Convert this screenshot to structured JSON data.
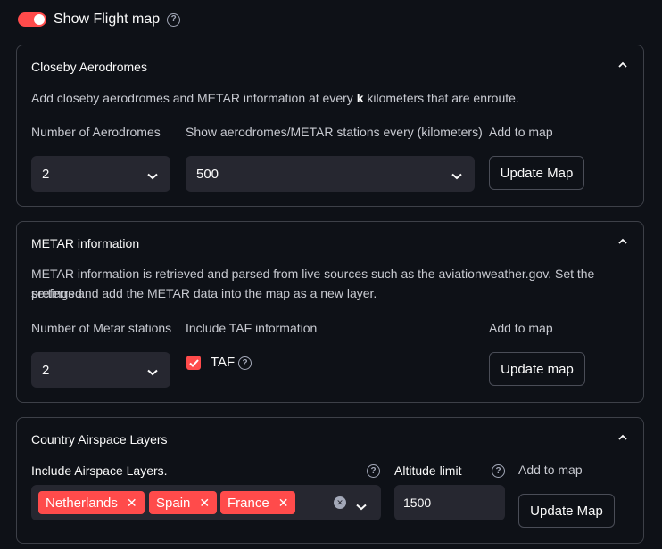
{
  "toggle": {
    "label": "Show Flight map",
    "on": true
  },
  "aerodromes": {
    "title": "Closeby Aerodromes",
    "desc_prefix": "Add closeby aerodromes and METAR information at every",
    "desc_bold": "k",
    "desc_suffix": "kilometers that are enroute.",
    "count_label": "Number of Aerodromes",
    "count_value": "2",
    "every_label": "Show aerodromes/METAR stations every (kilometers)",
    "every_value": "500",
    "add_label": "Add to map",
    "button_label": "Update Map"
  },
  "metar": {
    "title": "METAR information",
    "desc_line1": "METAR information is retrieved and parsed from live sources such as the aviationweather.gov. Set the preferred",
    "desc_line2": "settings and add the METAR data into the map as a new layer.",
    "count_label": "Number of Metar stations",
    "count_value": "2",
    "taf_section_label": "Include TAF information",
    "taf_checkbox_label": "TAF",
    "taf_checked": true,
    "add_label": "Add to map",
    "button_label": "Update map"
  },
  "airspace": {
    "title": "Country Airspace Layers",
    "layers_label": "Include Airspace Layers.",
    "tags": [
      "Netherlands",
      "Spain",
      "France"
    ],
    "altitude_label": "Altitude limit",
    "altitude_value": "1500",
    "add_label": "Add to map",
    "button_label": "Update Map"
  },
  "colors": {
    "accent": "#ff4b4b",
    "background": "#0e1117",
    "input": "#262730",
    "border": "#3d4048"
  }
}
